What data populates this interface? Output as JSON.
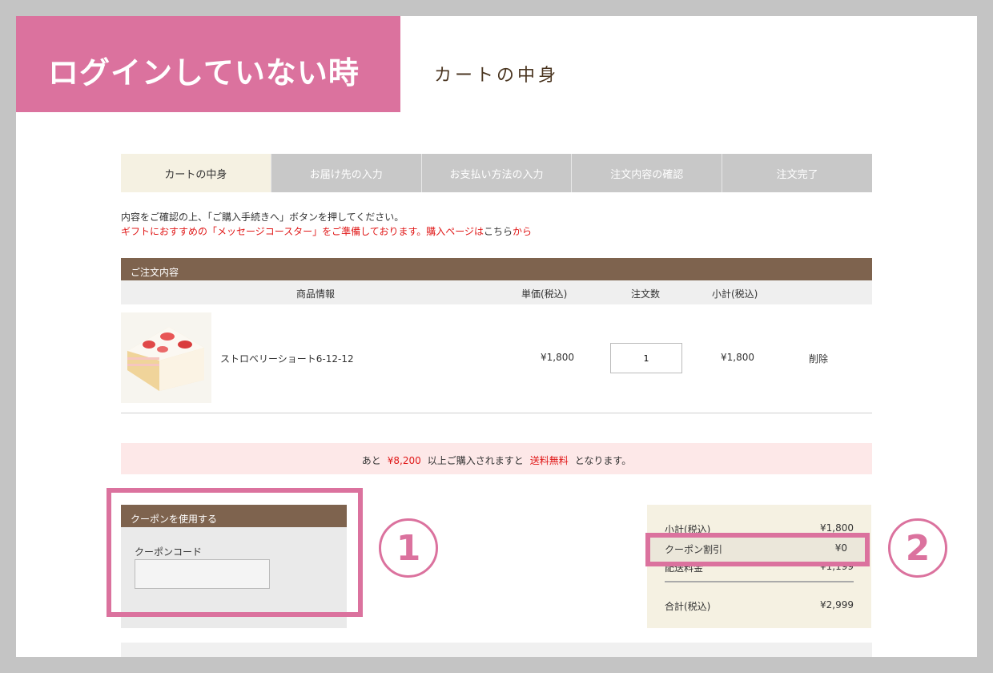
{
  "banner": {
    "text": "ログインしていない時"
  },
  "page_title": "カートの中身",
  "steps": [
    {
      "label": "カートの中身"
    },
    {
      "label": "お届け先の入力"
    },
    {
      "label": "お支払い方法の入力"
    },
    {
      "label": "注文内容の確認"
    },
    {
      "label": "注文完了"
    }
  ],
  "instructions": {
    "line1": "内容をご確認の上、「ご購入手続きへ」ボタンを押してください。",
    "line2_red": "ギフトにおすすめの「メッセージコースター」をご準備しております。購入ページは",
    "line2_link": "こちら",
    "line2_end": "から"
  },
  "order": {
    "heading": "ご注文内容",
    "columns": {
      "product": "商品情報",
      "unit_price": "単価(税込)",
      "quantity": "注文数",
      "subtotal": "小計(税込)"
    },
    "items": [
      {
        "name": "ストロベリーショート6-12-12",
        "unit_price": "¥1,800",
        "quantity": "1",
        "subtotal": "¥1,800",
        "delete_label": "削除"
      }
    ]
  },
  "shipping_notice": {
    "prefix": "あと",
    "amount": "¥8,200",
    "middle": "以上ご購入されますと",
    "free": "送料無料",
    "suffix": "となります。"
  },
  "coupon": {
    "heading": "クーポンを使用する",
    "code_label": "クーポンコード",
    "placeholder": ""
  },
  "summary": {
    "subtotal_label": "小計(税込)",
    "subtotal_value": "¥1,800",
    "coupon_label": "クーポン割引",
    "coupon_value": "¥0",
    "shipping_label": "配送料金",
    "shipping_value": "¥1,199",
    "total_label": "合計(税込)",
    "total_value": "¥2,999"
  },
  "annotations": {
    "one": "1",
    "two": "2"
  },
  "colors": {
    "accent_pink": "#db729e",
    "header_brown": "#7e634e",
    "red_text": "#e01818"
  }
}
